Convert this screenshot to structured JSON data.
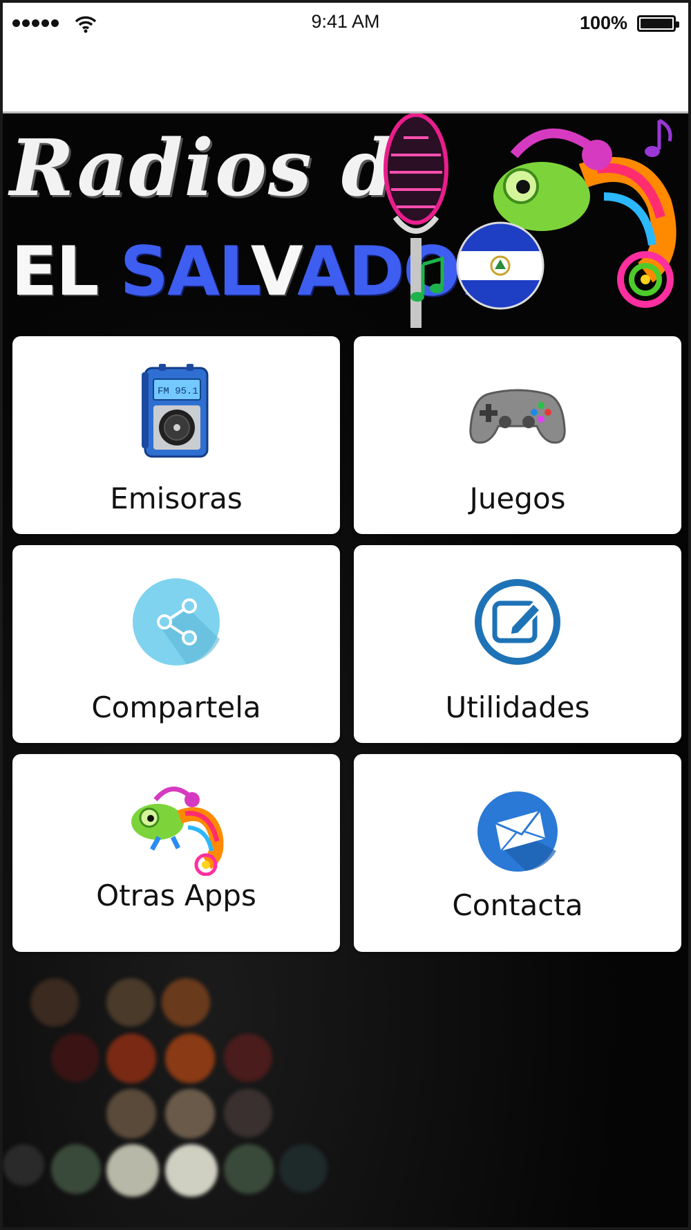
{
  "status_bar": {
    "time": "9:41 AM",
    "battery": "100%"
  },
  "banner": {
    "line1": "Radios de",
    "line2_white_a": "EL ",
    "line2_blue_a": "SAL",
    "line2_white_b": "V",
    "line2_blue_b": "ADOR"
  },
  "menu": [
    {
      "label": "Emisoras",
      "icon": "radio-icon"
    },
    {
      "label": "Juegos",
      "icon": "gamepad-icon"
    },
    {
      "label": "Compartela",
      "icon": "share-icon"
    },
    {
      "label": "Utilidades",
      "icon": "edit-icon"
    },
    {
      "label": "Otras Apps",
      "icon": "chameleon-icon"
    },
    {
      "label": "Contacta",
      "icon": "mail-icon"
    }
  ],
  "colors": {
    "banner_blue": "#3d5ef0",
    "share_circle": "#7fd3ef",
    "edit_ring": "#1e73b7",
    "mail_circle": "#2b79d6"
  }
}
